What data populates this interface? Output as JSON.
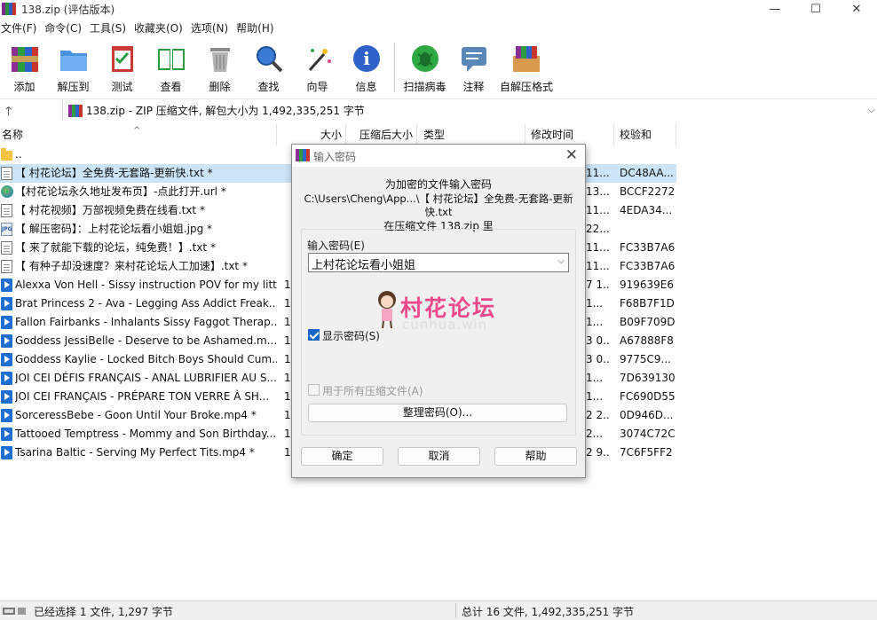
{
  "window": {
    "title": "138.zip (评估版本)"
  },
  "menu": [
    "文件(F)",
    "命令(C)",
    "工具(S)",
    "收藏夹(O)",
    "选项(N)",
    "帮助(H)"
  ],
  "toolbar": [
    {
      "label": "添加",
      "icon": "add-icon"
    },
    {
      "label": "解压到",
      "icon": "extract-to-icon"
    },
    {
      "label": "测试",
      "icon": "test-icon"
    },
    {
      "label": "查看",
      "icon": "view-icon"
    },
    {
      "label": "删除",
      "icon": "delete-icon"
    },
    {
      "label": "查找",
      "icon": "find-icon"
    },
    {
      "label": "向导",
      "icon": "wizard-icon"
    },
    {
      "label": "信息",
      "icon": "info-icon"
    },
    {
      "label": "扫描病毒",
      "icon": "scan-virus-icon"
    },
    {
      "label": "注释",
      "icon": "comment-icon"
    },
    {
      "label": "自解压格式",
      "icon": "sfx-icon"
    }
  ],
  "address": "138.zip - ZIP 压缩文件, 解包大小为 1,492,335,251 字节",
  "columns": {
    "name": "名称",
    "size": "大小",
    "packed": "压缩后大小",
    "type": "类型",
    "modified": "修改时间",
    "crc": "校验和"
  },
  "files": [
    {
      "name": "..",
      "icon": "folder",
      "size": "",
      "packed": "",
      "crc": ""
    },
    {
      "name": "【 村花论坛】全免费-无套路-更新快.txt *",
      "icon": "txt",
      "size": "",
      "packed": "11...",
      "crc": "DC48AA..."
    },
    {
      "name": "【村花论坛永久地址发布页】-点此打开.url *",
      "icon": "url",
      "size": "",
      "packed": "13...",
      "crc": "BCCF2272"
    },
    {
      "name": "【 村花视频】万部视频免费在线看.txt *",
      "icon": "txt",
      "size": "",
      "packed": "11...",
      "crc": "4EDA34..."
    },
    {
      "name": "【 解压密码】：上村花论坛看小姐姐.jpg *",
      "icon": "jpg",
      "size": "",
      "packed": "22...",
      "crc": ""
    },
    {
      "name": "【 来了就能下载的论坛，纯免费！】.txt *",
      "icon": "txt",
      "size": "",
      "packed": "11...",
      "crc": "FC33B7A6"
    },
    {
      "name": "【 有种子却没速度？来村花论坛人工加速】.txt *",
      "icon": "txt",
      "size": "",
      "packed": "11...",
      "crc": "FC33B7A6"
    },
    {
      "name": "Alexxa Von Hell - Sissy instruction POV for my litt...",
      "icon": "mp4",
      "size": "1",
      "packed": "7 1...",
      "crc": "919639E6"
    },
    {
      "name": "Brat Princess 2 - Ava - Legging Ass Addict Freak...",
      "icon": "mp4",
      "size": "1",
      "packed": "1...",
      "crc": "F68B7F1D"
    },
    {
      "name": "Fallon Fairbanks - Inhalants Sissy Faggot Therap...",
      "icon": "mp4",
      "size": "1",
      "packed": "1...",
      "crc": "B09F709D"
    },
    {
      "name": "Goddess JessiBelle - Deserve to be Ashamed.m...",
      "icon": "mp4",
      "size": "1",
      "packed": "3 0...",
      "crc": "A67888F8"
    },
    {
      "name": "Goddess Kaylie - Locked Bitch Boys Should Cum...",
      "icon": "mp4",
      "size": "1",
      "packed": "3 0...",
      "crc": "9775C9..."
    },
    {
      "name": "JOI CEI DÉFIS FRANÇAIS - ANAL LUBRIFIER AU S...",
      "icon": "mp4",
      "size": "1",
      "packed": "1...",
      "crc": "7D639130"
    },
    {
      "name": "JOI CEI FRANÇAIS - PRÉPARE TON VERRE À SH...",
      "icon": "mp4",
      "size": "1",
      "packed": "1...",
      "crc": "FC690D55"
    },
    {
      "name": "SorceressBebe - Goon Until Your Broke.mp4 *",
      "icon": "mp4",
      "size": "1",
      "packed": "2 2...",
      "crc": "0D946D..."
    },
    {
      "name": "Tattooed Temptress - Mommy and Son Birthday...",
      "icon": "mp4",
      "size": "1",
      "packed": "2...",
      "crc": "3074C72C"
    },
    {
      "name": "Tsarina Baltic - Serving My Perfect Tits.mp4 *",
      "icon": "mp4",
      "size": "1",
      "packed": "2 9...",
      "crc": "7C6F5FF2"
    }
  ],
  "selected_index": 1,
  "status": {
    "left": "已经选择 1 文件, 1,297 字节",
    "right": "总计 16 文件, 1,492,335,251 字节"
  },
  "dialog": {
    "title": "输入密码",
    "msg1": "为加密的文件输入密码",
    "msg2": "C:\\Users\\Cheng\\App...\\【 村花论坛】全免费-无套路-更新快.txt",
    "msg3": "在压缩文件 138.zip 里",
    "pw_label": "输入密码(E)",
    "pw_value": "上村花论坛看小姐姐",
    "show_pw_label": "显示密码(S)",
    "show_pw_checked": true,
    "all_archives_label": "用于所有压缩文件(A)",
    "all_archives_checked": false,
    "organize_label": "整理密码(O)...",
    "ok_label": "确定",
    "cancel_label": "取消",
    "help_label": "帮助",
    "watermark": {
      "text": "村花论坛",
      "sub": "cunhua.win"
    }
  },
  "colors": {
    "selection": "#cce4f7",
    "accent": "#1a66c4",
    "watermark": "#ec4a8c"
  }
}
